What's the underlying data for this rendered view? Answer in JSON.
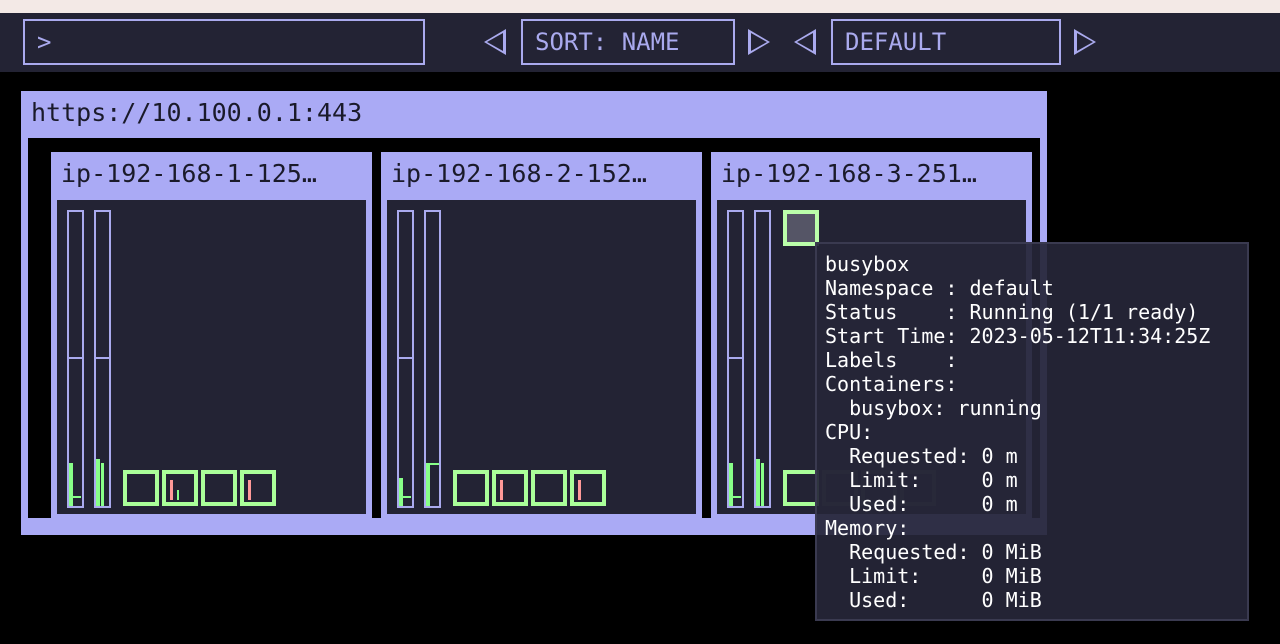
{
  "filter": {
    "value": ">"
  },
  "sort": {
    "label": "SORT: NAME"
  },
  "theme": {
    "label": "DEFAULT"
  },
  "cluster": {
    "url": "https://10.100.0.1:443"
  },
  "nodes": [
    {
      "name": "ip-192-168-1-125…"
    },
    {
      "name": "ip-192-168-2-152…"
    },
    {
      "name": "ip-192-168-3-251…"
    }
  ],
  "tooltip": {
    "lines": [
      "busybox",
      "Namespace : default",
      "Status    : Running (1/1 ready)",
      "Start Time: 2023-05-12T11:34:25Z",
      "Labels    :",
      "Containers:",
      "  busybox: running",
      "CPU:",
      "  Requested: 0 m",
      "  Limit:     0 m",
      "  Used:      0 m",
      "Memory:",
      "  Requested: 0 MiB",
      "  Limit:     0 MiB",
      "  Used:      0 MiB"
    ]
  },
  "colors": {
    "accent": "#aaaaee",
    "panel": "#aaaaf5",
    "node_bg": "#232334",
    "pod_border": "#aaff99",
    "usage_green": "#88ff88",
    "usage_red": "#ff9999"
  }
}
